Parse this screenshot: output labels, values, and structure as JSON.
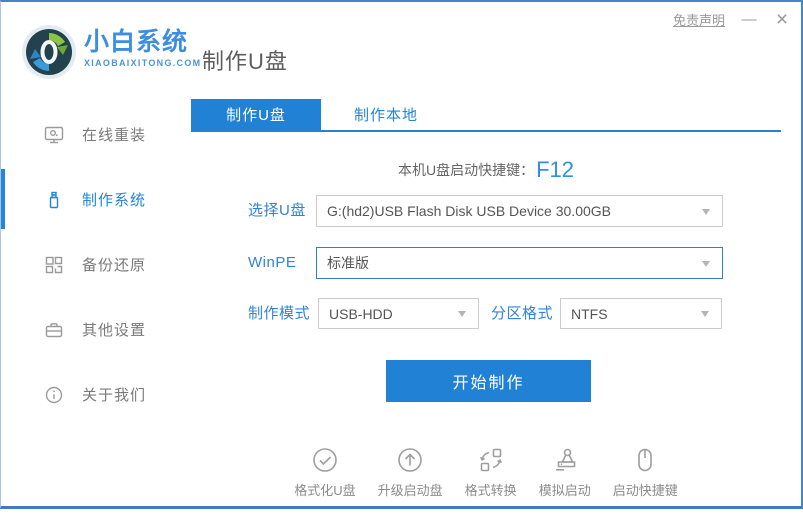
{
  "window": {
    "disclaimer": "免责声明",
    "minimize": "—",
    "close": "×"
  },
  "brand": {
    "name": "小白系统",
    "domain": "XIAOBAIXITONG.COM",
    "logo_icon": "refresh-arrows-logo"
  },
  "header": {
    "title": "制作U盘"
  },
  "sidebar": {
    "items": [
      {
        "label": "在线重装",
        "icon": "monitor-reinstall-icon",
        "active": false
      },
      {
        "label": "制作系统",
        "icon": "usb-drive-icon",
        "active": true
      },
      {
        "label": "备份还原",
        "icon": "backup-restore-icon",
        "active": false
      },
      {
        "label": "其他设置",
        "icon": "settings-case-icon",
        "active": false
      },
      {
        "label": "关于我们",
        "icon": "about-info-icon",
        "active": false
      }
    ]
  },
  "tabs": [
    {
      "label": "制作U盘",
      "active": true
    },
    {
      "label": "制作本地",
      "active": false
    }
  ],
  "main": {
    "hotkey_label": "本机U盘启动快捷键：",
    "hotkey_value": "F12",
    "fields": {
      "usb_label": "选择U盘",
      "usb_value": "G:(hd2)USB Flash Disk USB Device 30.00GB",
      "winpe_label": "WinPE",
      "winpe_value": "标准版",
      "mode_label": "制作模式",
      "mode_value": "USB-HDD",
      "partition_label": "分区格式",
      "partition_value": "NTFS"
    },
    "start_button": "开始制作"
  },
  "footer": {
    "tools": [
      {
        "label": "格式化U盘",
        "icon": "format-usb-icon"
      },
      {
        "label": "升级启动盘",
        "icon": "upgrade-boot-icon"
      },
      {
        "label": "格式转换",
        "icon": "format-convert-icon"
      },
      {
        "label": "模拟启动",
        "icon": "simulate-boot-icon"
      },
      {
        "label": "启动快捷键",
        "icon": "boot-hotkey-icon"
      }
    ]
  },
  "colors": {
    "primary_blue": "#2181D4",
    "label_blue": "#2E84DC",
    "hotkey_blue": "#2E8FE8",
    "tab_underline": "#2E7FD0",
    "window_border": "#4586CB",
    "muted_gray": "#8C8C8C"
  }
}
